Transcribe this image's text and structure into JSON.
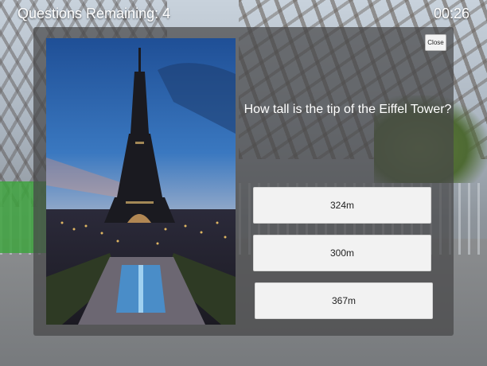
{
  "hud": {
    "questions_remaining": "Questions Remaining: 4",
    "timer": "00:26"
  },
  "panel": {
    "close_label": "Close",
    "question": "How tall is the tip of the Eiffel Tower?",
    "answers": [
      "324m",
      "300m",
      "367m"
    ],
    "photo_icon": "eiffel-tower-night-photo"
  },
  "colors": {
    "panel_bg": "#464648",
    "answer_bg": "#f2f2f2",
    "text_light": "#ffffff"
  }
}
